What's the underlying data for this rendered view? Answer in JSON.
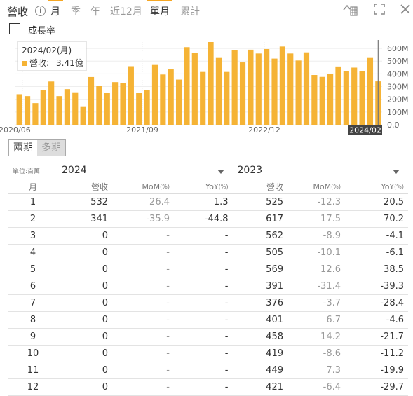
{
  "header": {
    "title": "營收",
    "info_glyph": "i",
    "tabs": [
      {
        "label": "月",
        "active": true,
        "highlight": true
      },
      {
        "label": "季",
        "active": false,
        "highlight": false
      },
      {
        "label": "年",
        "active": false,
        "highlight": false
      },
      {
        "label": "近12月",
        "active": false,
        "highlight": false
      },
      {
        "label": "單月",
        "active": true,
        "highlight": true
      },
      {
        "label": "累計",
        "active": false,
        "highlight": false
      }
    ],
    "icons": [
      "chart-style-icon",
      "fullscreen-icon",
      "close-icon"
    ]
  },
  "growth_checkbox": {
    "label": "成長率",
    "checked": false
  },
  "chart_data": {
    "type": "bar",
    "bar_color": "#f5b335",
    "tooltip": {
      "title": "2024/02(月)",
      "series_label": "營收:",
      "value_text": "3.41億"
    },
    "x_tick_labels": [
      "2020/06",
      "2021/09",
      "2022/12",
      "2024/02"
    ],
    "y_tick_labels": [
      "600M",
      "500M",
      "400M",
      "300M",
      "200M",
      "100M",
      "0.0"
    ],
    "y_ticks": [
      600,
      500,
      400,
      300,
      200,
      100,
      0
    ],
    "ylim": [
      0,
      650
    ],
    "grid": true,
    "values": [
      240,
      225,
      170,
      270,
      340,
      225,
      280,
      255,
      145,
      375,
      305,
      250,
      335,
      325,
      460,
      250,
      270,
      470,
      395,
      435,
      355,
      610,
      565,
      415,
      650,
      525,
      415,
      585,
      490,
      590,
      560,
      595,
      520,
      615,
      560,
      505,
      569,
      391,
      376,
      401,
      458,
      419,
      449,
      421,
      525,
      341
    ]
  },
  "period_toggle": {
    "options": [
      "兩期",
      "多期"
    ],
    "active": "兩期"
  },
  "table": {
    "unit_label": "單位:百萬",
    "year_left": "2024",
    "year_right": "2023",
    "col_month": "月",
    "col_revenue": "營收",
    "col_mom": "MoM",
    "col_yoy": "YoY",
    "pct": "(%)",
    "rows": [
      {
        "m": "1",
        "r1": "532",
        "mom1": "26.4",
        "yoy1": "1.3",
        "r2": "525",
        "mom2": "-12.3",
        "yoy2": "20.5"
      },
      {
        "m": "2",
        "r1": "341",
        "mom1": "-35.9",
        "yoy1": "-44.8",
        "r2": "617",
        "mom2": "17.5",
        "yoy2": "70.2"
      },
      {
        "m": "3",
        "r1": "0",
        "mom1": "-",
        "yoy1": "-",
        "r2": "562",
        "mom2": "-8.9",
        "yoy2": "-4.1"
      },
      {
        "m": "4",
        "r1": "0",
        "mom1": "-",
        "yoy1": "-",
        "r2": "505",
        "mom2": "-10.1",
        "yoy2": "-6.1"
      },
      {
        "m": "5",
        "r1": "0",
        "mom1": "-",
        "yoy1": "-",
        "r2": "569",
        "mom2": "12.6",
        "yoy2": "38.5"
      },
      {
        "m": "6",
        "r1": "0",
        "mom1": "-",
        "yoy1": "-",
        "r2": "391",
        "mom2": "-31.4",
        "yoy2": "-39.3"
      },
      {
        "m": "7",
        "r1": "0",
        "mom1": "-",
        "yoy1": "-",
        "r2": "376",
        "mom2": "-3.7",
        "yoy2": "-28.4"
      },
      {
        "m": "8",
        "r1": "0",
        "mom1": "-",
        "yoy1": "-",
        "r2": "401",
        "mom2": "6.7",
        "yoy2": "-4.6"
      },
      {
        "m": "9",
        "r1": "0",
        "mom1": "-",
        "yoy1": "-",
        "r2": "458",
        "mom2": "14.2",
        "yoy2": "-21.7"
      },
      {
        "m": "10",
        "r1": "0",
        "mom1": "-",
        "yoy1": "-",
        "r2": "419",
        "mom2": "-8.6",
        "yoy2": "-11.2"
      },
      {
        "m": "11",
        "r1": "0",
        "mom1": "-",
        "yoy1": "-",
        "r2": "449",
        "mom2": "7.3",
        "yoy2": "-19.9"
      },
      {
        "m": "12",
        "r1": "0",
        "mom1": "-",
        "yoy1": "-",
        "r2": "421",
        "mom2": "-6.4",
        "yoy2": "-29.7"
      }
    ]
  }
}
